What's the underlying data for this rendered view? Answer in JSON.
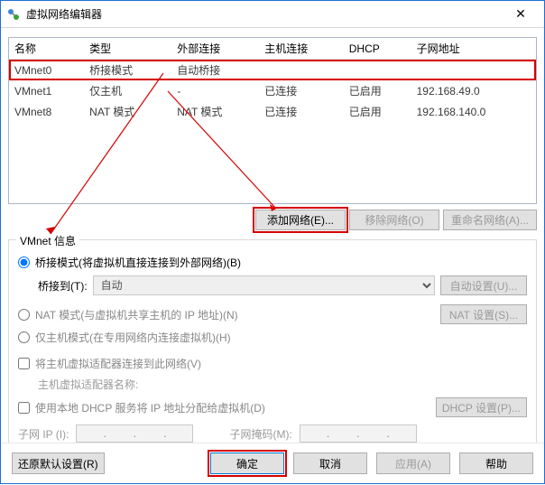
{
  "window": {
    "title": "虚拟网络编辑器",
    "close": "✕"
  },
  "table": {
    "headers": [
      "名称",
      "类型",
      "外部连接",
      "主机连接",
      "DHCP",
      "子网地址"
    ],
    "rows": [
      {
        "name": "VMnet0",
        "type": "桥接模式",
        "ext": "自动桥接",
        "host": "",
        "dhcp": "",
        "subnet": ""
      },
      {
        "name": "VMnet1",
        "type": "仅主机",
        "ext": "-",
        "host": "已连接",
        "dhcp": "已启用",
        "subnet": "192.168.49.0"
      },
      {
        "name": "VMnet8",
        "type": "NAT 模式",
        "ext": "NAT 模式",
        "host": "已连接",
        "dhcp": "已启用",
        "subnet": "192.168.140.0"
      }
    ]
  },
  "buttons": {
    "add_network": "添加网络(E)...",
    "remove_network": "移除网络(O)",
    "rename_network": "重命名网络(A)..."
  },
  "group": {
    "title": "VMnet 信息",
    "bridge_radio": "桥接模式(将虚拟机直接连接到外部网络)(B)",
    "bridge_to_label": "桥接到(T):",
    "bridge_to_value": "自动",
    "auto_settings": "自动设置(U)...",
    "nat_radio": "NAT 模式(与虚拟机共享主机的 IP 地址)(N)",
    "nat_settings": "NAT 设置(S)...",
    "hostonly_radio": "仅主机模式(在专用网络内连接虚拟机)(H)",
    "connect_host_check": "将主机虚拟适配器连接到此网络(V)",
    "host_adapter_name_label": "主机虚拟适配器名称:",
    "use_dhcp_check": "使用本地 DHCP 服务将 IP 地址分配给虚拟机(D)",
    "dhcp_settings": "DHCP 设置(P)...",
    "subnet_ip_label": "子网 IP (I):",
    "subnet_mask_label": "子网掩码(M):"
  },
  "footer": {
    "restore_defaults": "还原默认设置(R)",
    "ok": "确定",
    "cancel": "取消",
    "apply": "应用(A)",
    "help": "帮助"
  }
}
